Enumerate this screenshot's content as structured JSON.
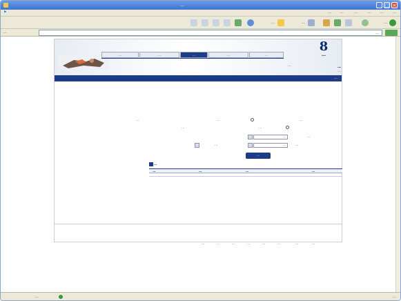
{
  "browser": {
    "title": "…",
    "menu": [
      "…",
      "…",
      "…",
      "…",
      "…",
      "…"
    ],
    "toolbar_labels": [
      "…",
      "…",
      "…"
    ],
    "address": {
      "label": "…",
      "url": "…"
    },
    "status": {
      "right": "…",
      "zone": "…"
    }
  },
  "site": {
    "brand_number": "8",
    "brand_name": "…",
    "header_link": "…",
    "navbar_title": "…",
    "tabs": [
      "…",
      "…",
      "…",
      "…",
      "…"
    ],
    "section_title": "…",
    "section_subtitle": "…",
    "form": {
      "label_type": "…",
      "option_a": "…",
      "option_a_note": "…",
      "option_b": "…",
      "option_b_note": "…",
      "label_date": "…",
      "date_value": "…",
      "label_from": "…",
      "from_value": "…",
      "label_to": "…",
      "submit": "…"
    },
    "results_label": "…",
    "table_headers": [
      "…",
      "…",
      "…",
      "…"
    ],
    "footer_links": [
      "…",
      "…",
      "…",
      "…",
      "…",
      "…",
      "…",
      "…"
    ]
  }
}
